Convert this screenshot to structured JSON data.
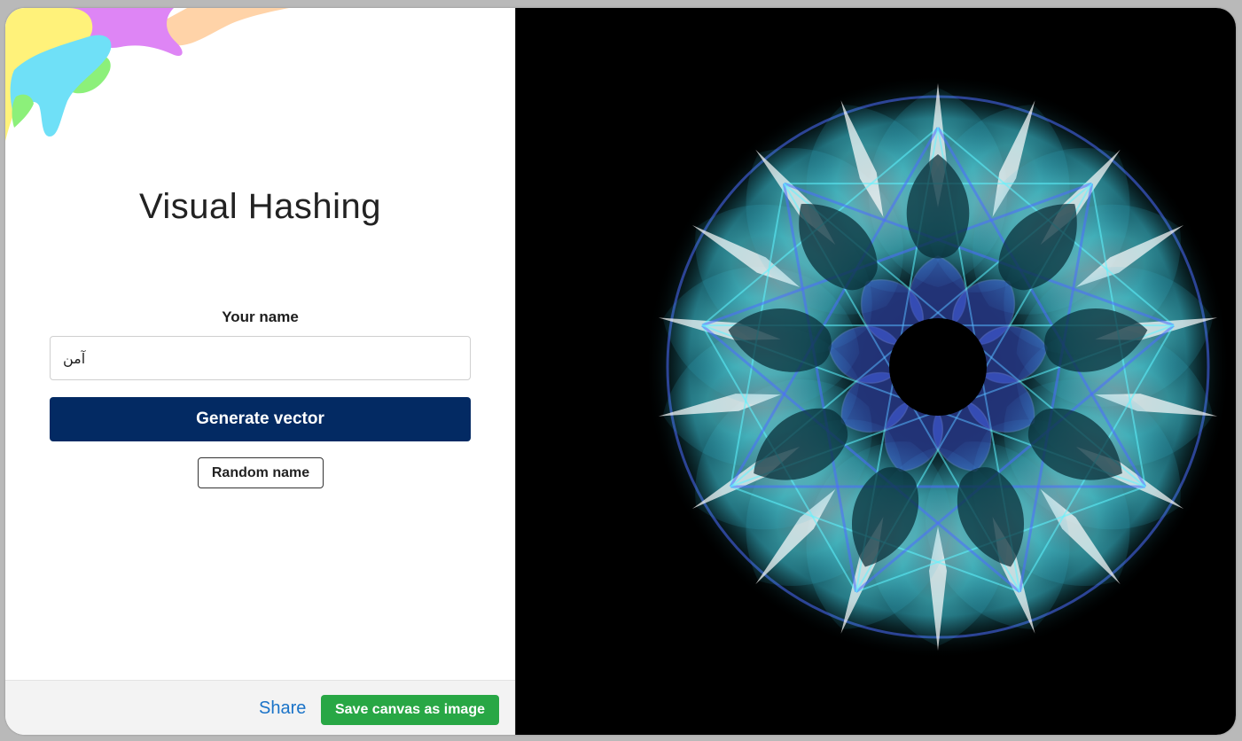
{
  "app": {
    "title": "Visual Hashing"
  },
  "form": {
    "name_label": "Your name",
    "name_value": "آمن",
    "generate_label": "Generate vector",
    "random_label": "Random name"
  },
  "footer": {
    "share_label": "Share",
    "save_label": "Save canvas as image"
  },
  "colors": {
    "primary": "#032a63",
    "success": "#28a745",
    "link": "#1a73c8",
    "canvas_background": "#000000",
    "pattern_cyan": "#5ff4ff",
    "pattern_blue": "#4c6cff"
  },
  "canvas": {
    "symmetry_folds": 9
  }
}
